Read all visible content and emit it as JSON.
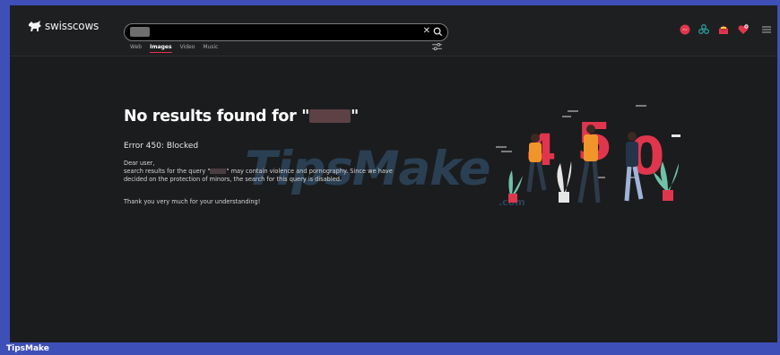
{
  "header": {
    "logo_text": "swisscows",
    "search": {
      "value": "",
      "placeholder": ""
    },
    "tabs": [
      {
        "label": "Web"
      },
      {
        "label": "Images"
      },
      {
        "label": "Video"
      },
      {
        "label": "Music"
      }
    ],
    "clear_glyph": "✕"
  },
  "content": {
    "title": "No results found for \"",
    "title_end": "\"",
    "error": "Error 450: Blocked",
    "greeting": "Dear user,",
    "line1_a": "search results for the query \"",
    "line1_b": "\" may contain violence and pornography. Since we have",
    "line2": "decided on the protection of minors, the search for this query is disabled.",
    "thanks": "Thank you very much for your understanding!"
  },
  "illustration": {
    "digits": [
      "4",
      "5",
      "0"
    ]
  },
  "watermark": {
    "text": "TipsMake",
    "sub": ".com"
  },
  "footer": {
    "brand": "TipsMake"
  },
  "colors": {
    "accent": "#e0364d",
    "background": "#1b1c1e",
    "header": "#1e1f21",
    "frame": "#3f4fb8",
    "digit": "#e0364d",
    "figure_shirt": "#f0952a"
  },
  "icons": [
    "logo-cow-icon",
    "clear-icon",
    "search-icon",
    "filter-icon",
    "messenger-icon",
    "teamviewer-icon",
    "mail-icon",
    "heart-icon",
    "menu-icon"
  ]
}
